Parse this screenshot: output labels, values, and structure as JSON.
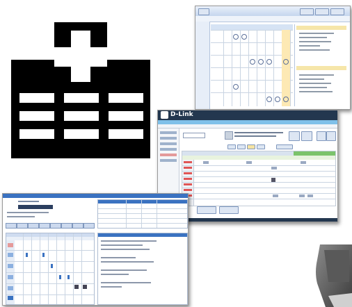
{
  "brand": {
    "logo_text": "D-Link"
  },
  "icons": {
    "hospital": "hospital-cross-icon",
    "phone": "phone-icon"
  },
  "colors": {
    "title_blue": "#2a6fc2",
    "header_light": "#cfe0f4",
    "toolbar_green": "#4c9a3c",
    "hospital_black": "#000000"
  }
}
